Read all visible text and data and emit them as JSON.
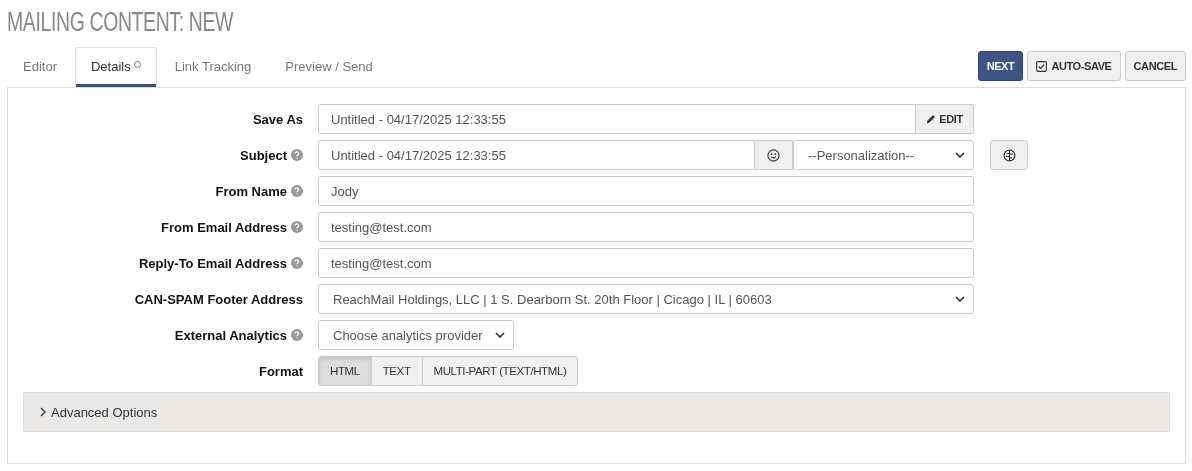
{
  "title": "MAILING CONTENT: NEW",
  "tabs": [
    {
      "label": "Editor",
      "selected": false,
      "modified": false
    },
    {
      "label": "Details",
      "selected": true,
      "modified": true
    },
    {
      "label": "Link Tracking",
      "selected": false,
      "modified": false
    },
    {
      "label": "Preview / Send",
      "selected": false,
      "modified": false
    }
  ],
  "actions": [
    {
      "label": "NEXT",
      "kind": "primary"
    },
    {
      "label": "AUTO-SAVE",
      "kind": "toggle",
      "checked": true
    },
    {
      "label": "CANCEL",
      "kind": "default"
    }
  ],
  "fields": [
    {
      "label": "Save As",
      "help": false,
      "kind": "text-edit",
      "value": "Untitled - 04/17/2025 12:33:55",
      "button": "EDIT"
    },
    {
      "label": "Subject",
      "help": true,
      "kind": "subject",
      "value": "Untitled - 04/17/2025 12:33:55",
      "select": "--Personalization--"
    },
    {
      "label": "From Name",
      "help": true,
      "kind": "text",
      "value": "Jody"
    },
    {
      "label": "From Email Address",
      "help": true,
      "kind": "text",
      "value": "testing@test.com"
    },
    {
      "label": "Reply-To Email Address",
      "help": true,
      "kind": "text",
      "value": "testing@test.com"
    },
    {
      "label": "CAN-SPAM Footer Address",
      "help": false,
      "kind": "select",
      "value": "ReachMail Holdings, LLC | 1 S. Dearborn St. 20th Floor | Cicago | IL | 60603"
    },
    {
      "label": "External Analytics",
      "help": true,
      "kind": "select-small",
      "value": "Choose analytics provider"
    },
    {
      "label": "Format",
      "help": false,
      "kind": "segmented",
      "options": [
        {
          "label": "HTML",
          "selected": true
        },
        {
          "label": "TEXT",
          "selected": false
        },
        {
          "label": "MULTI-PART (TEXT/HTML)",
          "selected": false
        }
      ]
    }
  ],
  "advanced": {
    "label": "Advanced Options",
    "expanded": false
  }
}
